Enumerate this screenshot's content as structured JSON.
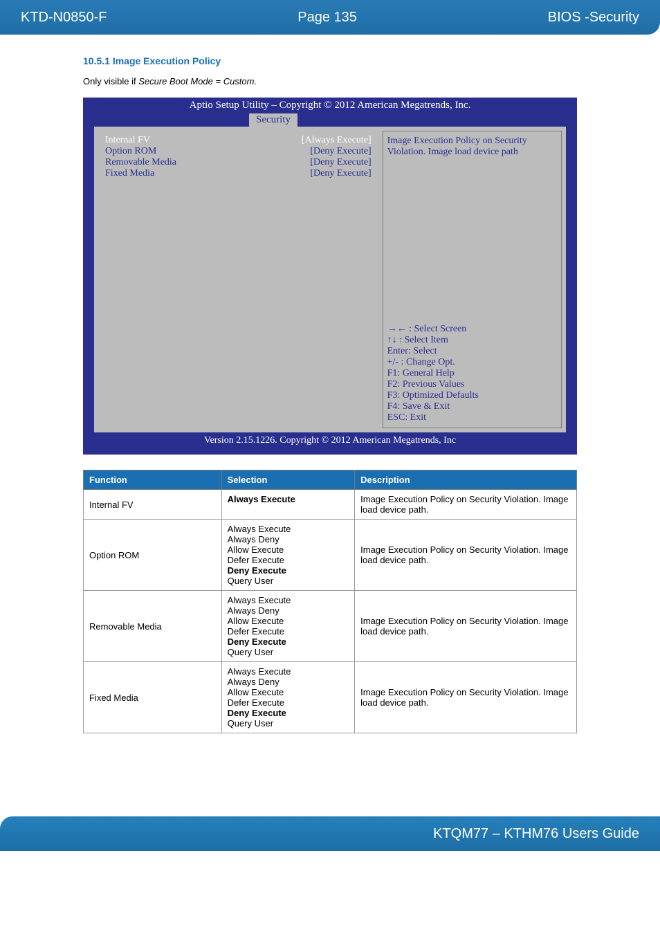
{
  "header": {
    "left": "KTD-N0850-F",
    "center": "Page 135",
    "right": "BIOS -Security"
  },
  "section": {
    "number_title": "10.5.1  Image Execution Policy",
    "note_prefix": "Only visible if ",
    "note_italic": "Secure Boot Mode = Custom."
  },
  "bios": {
    "caption": "Aptio Setup Utility  –  Copyright © 2012 American Megatrends, Inc.",
    "tab": "Security",
    "rows": [
      {
        "label": "Internal FV",
        "value": "[Always Execute]",
        "cls": "sel-white"
      },
      {
        "label": "Option ROM",
        "value": "[Deny Execute]",
        "cls": "sel-blue"
      },
      {
        "label": "Removable Media",
        "value": "[Deny Execute]",
        "cls": "sel-blue"
      },
      {
        "label": "Fixed Media",
        "value": "[Deny Execute]",
        "cls": "sel-blue"
      }
    ],
    "help_top": "Image Execution Policy on Security Violation. Image load device path",
    "help_bottom": "→← : Select Screen\n↑↓ : Select Item\nEnter: Select\n+/- : Change Opt.\nF1: General Help\nF2: Previous Values\nF3: Optimized Defaults\nF4: Save & Exit\nESC: Exit",
    "version": "Version 2.15.1226. Copyright © 2012 American Megatrends, Inc"
  },
  "table": {
    "headers": {
      "c1": "Function",
      "c2": "Selection",
      "c3": "Description"
    },
    "rows": [
      {
        "function": "Internal FV",
        "selection_lines": [
          {
            "text": "Always Execute",
            "bold": true
          }
        ],
        "description": "Image Execution Policy on Security Violation. Image load device path."
      },
      {
        "function": "Option ROM",
        "selection_lines": [
          {
            "text": "Always Execute",
            "bold": false
          },
          {
            "text": "Always Deny",
            "bold": false
          },
          {
            "text": "Allow Execute",
            "bold": false
          },
          {
            "text": "Defer Execute",
            "bold": false
          },
          {
            "text": "Deny Execute",
            "bold": true
          },
          {
            "text": "Query User",
            "bold": false
          }
        ],
        "description": "Image Execution Policy on Security Violation. Image load device path."
      },
      {
        "function": "Removable Media",
        "selection_lines": [
          {
            "text": "Always Execute",
            "bold": false
          },
          {
            "text": "Always Deny",
            "bold": false
          },
          {
            "text": "Allow Execute",
            "bold": false
          },
          {
            "text": "Defer Execute",
            "bold": false
          },
          {
            "text": "Deny Execute",
            "bold": true
          },
          {
            "text": "Query User",
            "bold": false
          }
        ],
        "description": "Image Execution Policy on Security Violation. Image load device path."
      },
      {
        "function": "Fixed Media",
        "selection_lines": [
          {
            "text": "Always Execute",
            "bold": false
          },
          {
            "text": "Always Deny",
            "bold": false
          },
          {
            "text": "Allow Execute",
            "bold": false
          },
          {
            "text": "Defer Execute",
            "bold": false
          },
          {
            "text": "Deny Execute",
            "bold": true
          },
          {
            "text": "Query User",
            "bold": false
          }
        ],
        "description": "Image Execution Policy on Security Violation. Image load device path."
      }
    ]
  },
  "footer": {
    "text": "KTQM77 – KTHM76 Users Guide"
  }
}
